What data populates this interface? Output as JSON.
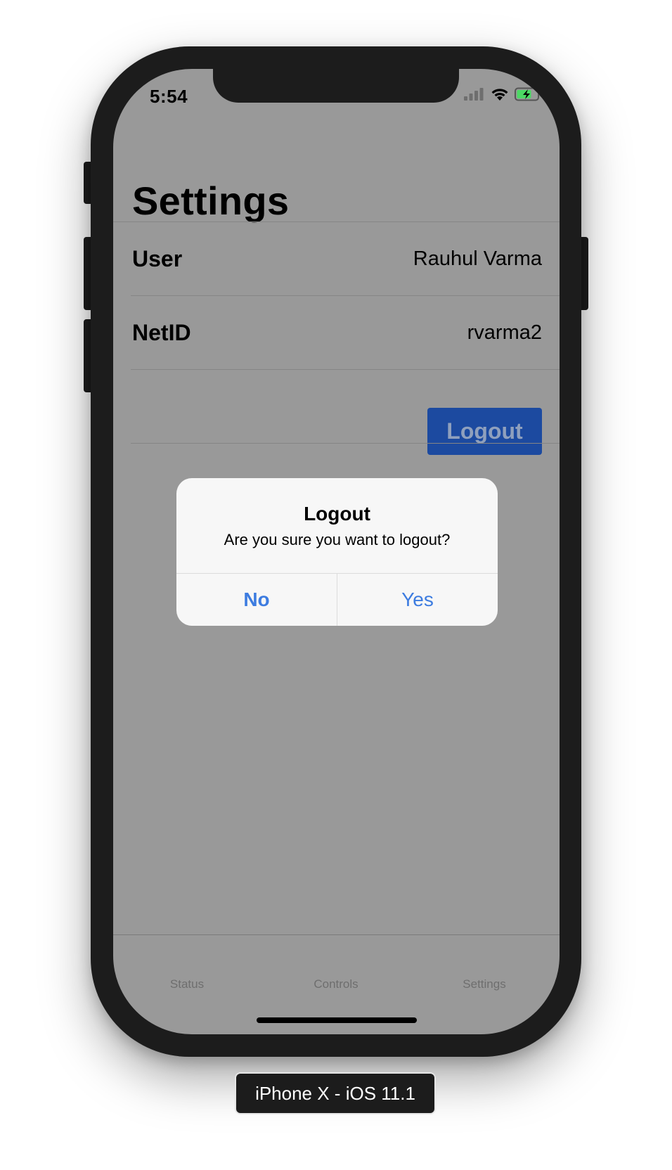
{
  "status_bar": {
    "time": "5:54",
    "icons": [
      "cellular-signal-icon",
      "wifi-icon",
      "battery-charging-icon"
    ]
  },
  "header": {
    "title": "Settings"
  },
  "rows": [
    {
      "label": "User",
      "value": "Rauhul Varma"
    },
    {
      "label": "NetID",
      "value": "rvarma2"
    }
  ],
  "logout_button": {
    "label": "Logout"
  },
  "alert": {
    "title": "Logout",
    "message": "Are you sure you want to logout?",
    "buttons": [
      {
        "label": "No"
      },
      {
        "label": "Yes"
      }
    ]
  },
  "tab_bar": {
    "tabs": [
      {
        "label": "Status"
      },
      {
        "label": "Controls"
      },
      {
        "label": "Settings"
      }
    ]
  },
  "device_label": "iPhone X - iOS 11.1",
  "colors": {
    "overlay_background": "#999999",
    "accent_blue": "#3d7ce0",
    "logout_button_bg": "#1c4aa0",
    "device_frame": "#1c1c1c"
  }
}
